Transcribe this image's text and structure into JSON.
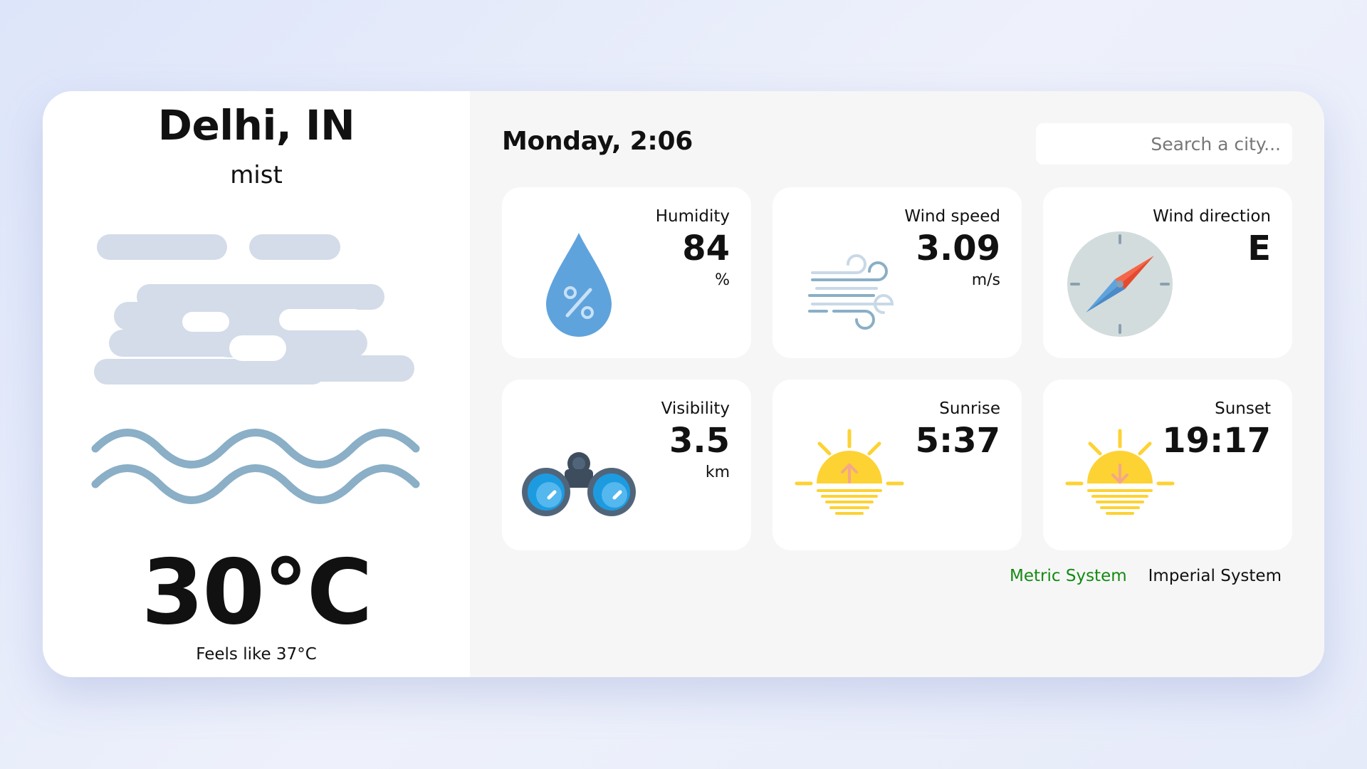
{
  "location": {
    "city": "Delhi, IN",
    "description": "mist",
    "temperature": "30°C",
    "feels_like": "Feels like 37°C",
    "main_icon": "mist-icon"
  },
  "header": {
    "datetime": "Monday, 2:06",
    "search_placeholder": "Search a city..."
  },
  "cards": [
    {
      "title": "Humidity",
      "value": "84",
      "unit": "%",
      "icon": "humidity-drop-icon"
    },
    {
      "title": "Wind speed",
      "value": "3.09",
      "unit": "m/s",
      "icon": "wind-icon"
    },
    {
      "title": "Wind direction",
      "value": "E",
      "unit": "",
      "icon": "compass-icon"
    },
    {
      "title": "Visibility",
      "value": "3.5",
      "unit": "km",
      "icon": "binoculars-icon"
    },
    {
      "title": "Sunrise",
      "value": "5:37",
      "unit": "",
      "icon": "sunrise-icon"
    },
    {
      "title": "Sunset",
      "value": "19:17",
      "unit": "",
      "icon": "sunset-icon"
    }
  ],
  "units": {
    "metric_label": "Metric System",
    "imperial_label": "Imperial System",
    "active": "metric"
  },
  "colors": {
    "active_unit": "#138a13",
    "mist_cloud": "#d3dce8",
    "mist_wave": "#8aafc6",
    "drop": "#5fa3dd",
    "sun": "#fdd233",
    "compass_needle": "#f5674a"
  }
}
